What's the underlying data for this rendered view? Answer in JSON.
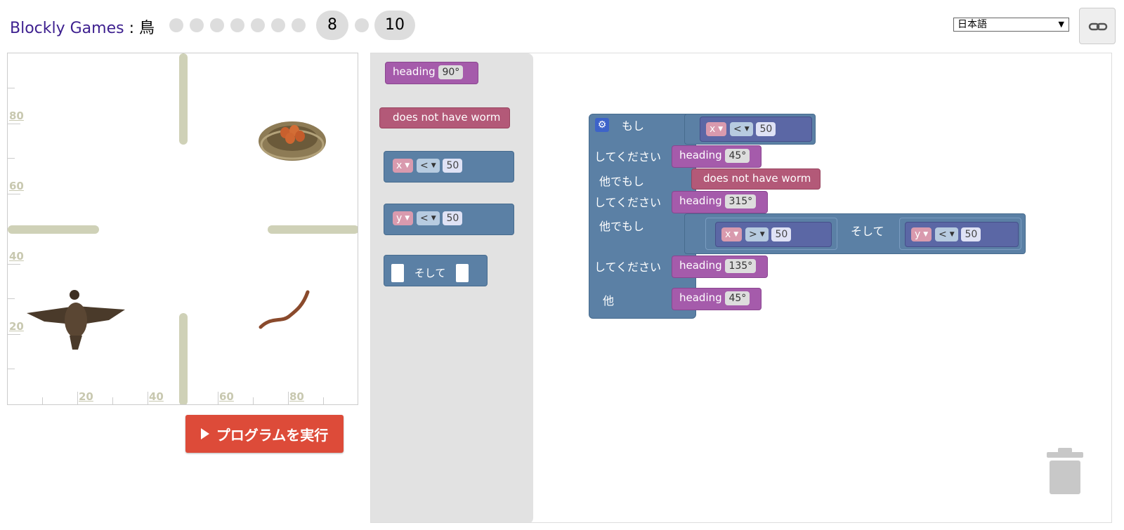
{
  "header": {
    "app_name": "Blockly Games",
    "separator": " : ",
    "game_name": "鳥",
    "levels": [
      "1",
      "2",
      "3",
      "4",
      "5",
      "6",
      "7",
      "8",
      "9",
      "10"
    ],
    "current_level": "8",
    "last_level": "10",
    "language": "日本語",
    "link_icon": "link-icon"
  },
  "visualization": {
    "y_labels": [
      "80",
      "60",
      "40",
      "20"
    ],
    "x_labels": [
      "20",
      "40",
      "60",
      "80"
    ],
    "sprites": [
      "bird-icon",
      "nest-icon",
      "worm-icon"
    ],
    "wall_color": "#cfd1b7"
  },
  "run_button": {
    "label": "プログラムを実行",
    "color": "#dd4b39"
  },
  "toolbox": {
    "heading_label": "heading",
    "heading_value": "90°",
    "no_worm_label": "does not have worm",
    "x_var": "x",
    "y_var": "y",
    "lt_op": "<",
    "compare_value": "50",
    "and_label": "そして"
  },
  "program": {
    "if_label": "もし",
    "do_label": "してください",
    "elseif_label": "他でもし",
    "else_label": "他",
    "and_label": "そして",
    "heading_label": "heading",
    "no_worm_label": "does not have worm",
    "cond1": {
      "var": "x",
      "op": "<",
      "value": "50"
    },
    "heading1": "45°",
    "heading2": "315°",
    "cond3a": {
      "var": "x",
      "op": ">",
      "value": "50"
    },
    "cond3b": {
      "var": "y",
      "op": "<",
      "value": "50"
    },
    "heading3": "135°",
    "heading4": "45°"
  },
  "colors": {
    "motion_purple": "#a55bab",
    "sensor_pink": "#b35978",
    "logic_blue": "#5b80a5",
    "math_navy": "#5b67a5"
  }
}
